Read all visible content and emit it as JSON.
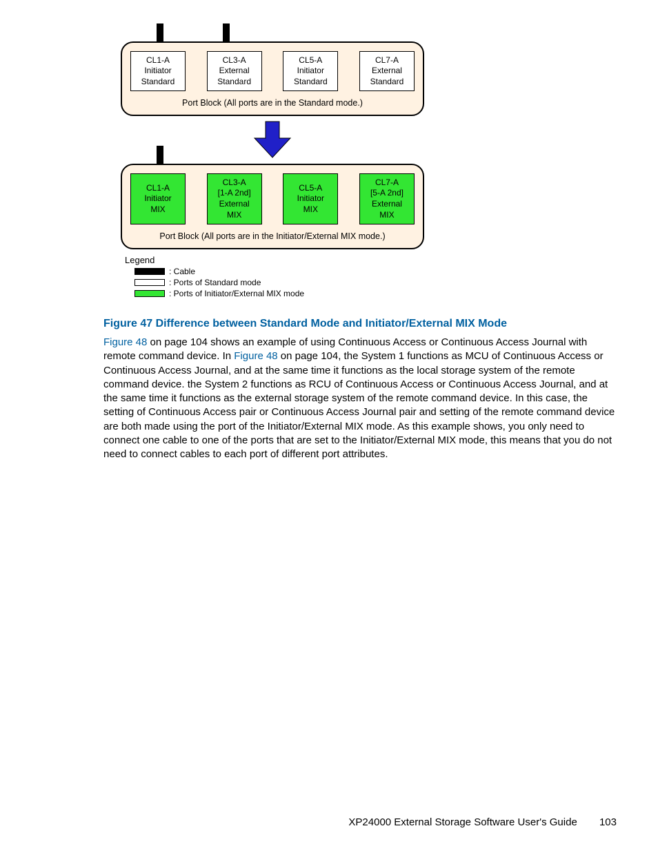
{
  "diagram": {
    "top_block": {
      "ports": [
        {
          "name": "CL1-A",
          "sub": "",
          "role": "Initiator",
          "mode": "Standard"
        },
        {
          "name": "CL3-A",
          "sub": "",
          "role": "External",
          "mode": "Standard"
        },
        {
          "name": "CL5-A",
          "sub": "",
          "role": "Initiator",
          "mode": "Standard"
        },
        {
          "name": "CL7-A",
          "sub": "",
          "role": "External",
          "mode": "Standard"
        }
      ],
      "caption": "Port Block (All ports are in the Standard mode.)"
    },
    "bottom_block": {
      "ports": [
        {
          "name": "CL1-A",
          "sub": "",
          "role": "Initiator",
          "mode": "MIX"
        },
        {
          "name": "CL3-A",
          "sub": "[1-A 2nd]",
          "role": "External",
          "mode": "MIX"
        },
        {
          "name": "CL5-A",
          "sub": "",
          "role": "Initiator",
          "mode": "MIX"
        },
        {
          "name": "CL7-A",
          "sub": "[5-A 2nd]",
          "role": "External",
          "mode": "MIX"
        }
      ],
      "caption": "Port Block (All ports are in the Initiator/External MIX mode.)"
    },
    "legend": {
      "title": "Legend",
      "cable": ": Cable",
      "standard": ": Ports of Standard mode",
      "mix": ": Ports of Initiator/External MIX mode"
    }
  },
  "figure_title": "Figure 47 Difference between Standard Mode and Initiator/External MIX Mode",
  "body": {
    "link1": "Figure 48",
    "t1": " on page 104 shows an example of using Continuous Access or Continuous Access Journal with remote command device. In ",
    "link2": "Figure 48",
    "t2": " on page 104, the System 1 functions as MCU of Continuous Access or Continuous Access Journal, and at the same time it functions as the local storage system of the remote command device. the System 2 functions as RCU of Continuous Access or Continuous Access Journal, and at the same time it functions as the external storage system of the remote command device. In this case, the setting of Continuous Access pair or Continuous Access Journal pair and setting of the remote command device are both made using the port of the Initiator/External MIX mode. As this example shows, you only need to connect one cable to one of the ports that are set to the Initiator/External MIX mode, this means that you do not need to connect cables to each port of different port attributes."
  },
  "footer": {
    "doc": "XP24000 External Storage Software User's Guide",
    "page": "103"
  }
}
